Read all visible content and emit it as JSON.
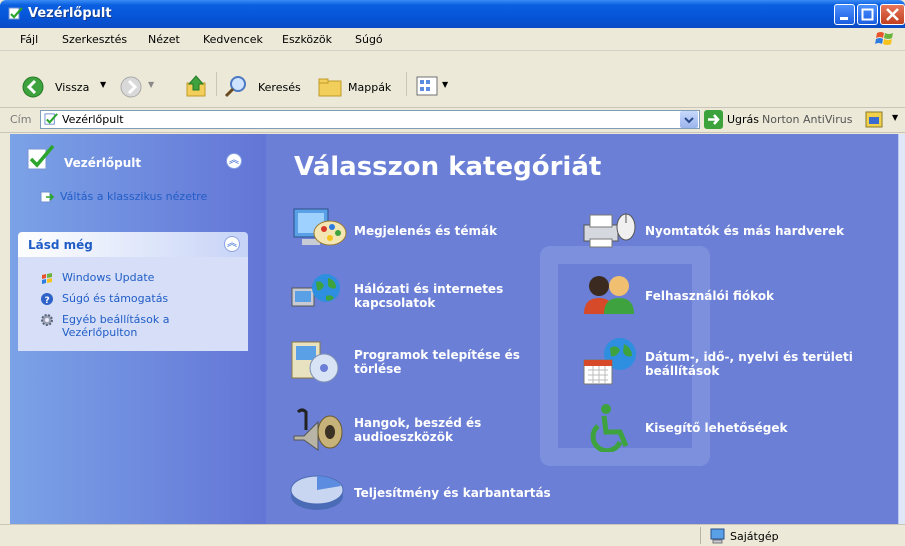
{
  "window": {
    "title": "Vezérlőpult"
  },
  "menu": [
    "Fájl",
    "Szerkesztés",
    "Nézet",
    "Kedvencek",
    "Eszközök",
    "Súgó"
  ],
  "toolbar": {
    "back": "Vissza",
    "search": "Keresés",
    "folders": "Mappák"
  },
  "address": {
    "label": "Cím",
    "value": "Vezérlőpult",
    "go": "Ugrás",
    "norton": "Norton AntiVirus"
  },
  "sidebar": {
    "main_panel": {
      "title": "Vezérlőpult",
      "link": "Váltás a klasszikus nézetre"
    },
    "see_also": {
      "title": "Lásd még",
      "links": [
        "Windows Update",
        "Súgó és támogatás",
        "Egyéb beállítások a Vezérlőpulton"
      ]
    }
  },
  "content": {
    "heading": "Válasszon kategóriát",
    "categories": [
      "Megjelenés és témák",
      "Hálózati és internetes kapcsolatok",
      "Programok telepítése és törlése",
      "Hangok, beszéd és audioeszközök",
      "Teljesítmény és karbantartás",
      "Nyomtatók és más hardverek",
      "Felhasználói fiókok",
      "Dátum-, idő-, nyelvi és területi beállítások",
      "Kisegítő lehetőségek"
    ]
  },
  "status": {
    "location": "Sajátgép"
  },
  "colors": {
    "title_bar": "#0655d8",
    "content_bg": "#6b7fd6",
    "sidebar_link": "#215dc6"
  }
}
